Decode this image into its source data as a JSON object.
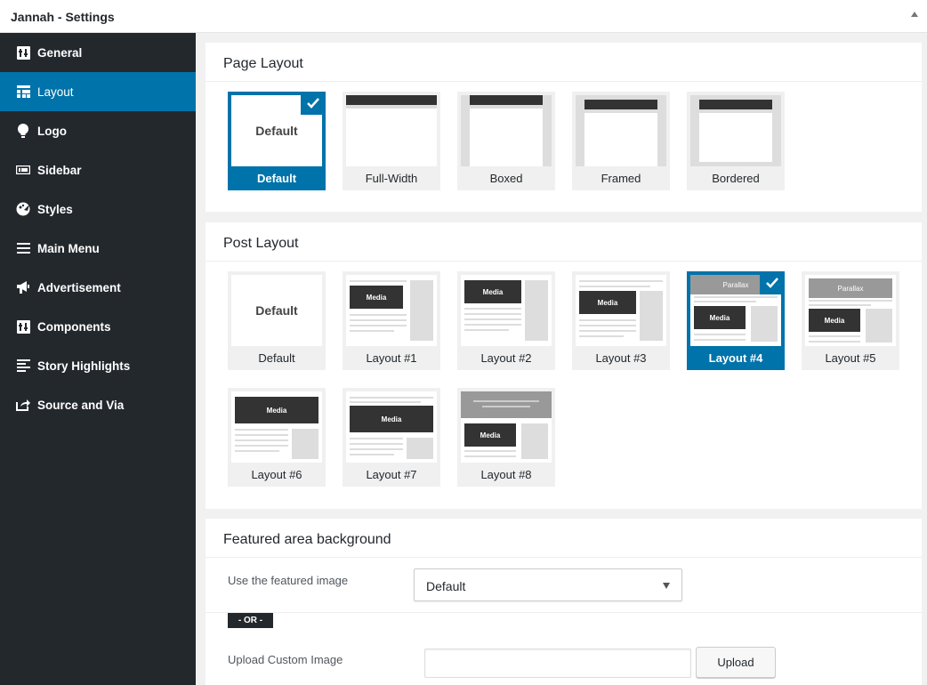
{
  "window": {
    "title": "Jannah - Settings"
  },
  "sidebar": {
    "items": [
      {
        "label": "General",
        "icon": "general-icon"
      },
      {
        "label": "Layout",
        "icon": "layout-icon",
        "active": true
      },
      {
        "label": "Logo",
        "icon": "lightbulb-icon"
      },
      {
        "label": "Sidebar",
        "icon": "sidebar-icon"
      },
      {
        "label": "Styles",
        "icon": "palette-icon"
      },
      {
        "label": "Main Menu",
        "icon": "menu-icon"
      },
      {
        "label": "Advertisement",
        "icon": "megaphone-icon"
      },
      {
        "label": "Components",
        "icon": "components-icon"
      },
      {
        "label": "Story Highlights",
        "icon": "list-icon"
      },
      {
        "label": "Source and Via",
        "icon": "share-icon"
      }
    ]
  },
  "page_layout": {
    "title": "Page Layout",
    "selected": "Default",
    "options": [
      {
        "label": "Default",
        "thumb_text": "Default"
      },
      {
        "label": "Full-Width"
      },
      {
        "label": "Boxed"
      },
      {
        "label": "Framed"
      },
      {
        "label": "Bordered"
      }
    ]
  },
  "post_layout": {
    "title": "Post Layout",
    "selected": "Layout #4",
    "media_text": "Media",
    "parallax_text": "Parallax",
    "options": [
      {
        "label": "Default",
        "thumb_text": "Default"
      },
      {
        "label": "Layout #1"
      },
      {
        "label": "Layout #2"
      },
      {
        "label": "Layout #3"
      },
      {
        "label": "Layout #4"
      },
      {
        "label": "Layout #5"
      },
      {
        "label": "Layout #6"
      },
      {
        "label": "Layout #7"
      },
      {
        "label": "Layout #8"
      }
    ]
  },
  "featured": {
    "title": "Featured area background",
    "use_image_label": "Use the featured image",
    "use_image_value": "Default",
    "or_text": "- OR -",
    "upload_label": "Upload Custom Image",
    "upload_value": "",
    "upload_button": "Upload"
  },
  "colors": {
    "accent": "#0073aa",
    "sidebar_bg": "#23282d"
  }
}
